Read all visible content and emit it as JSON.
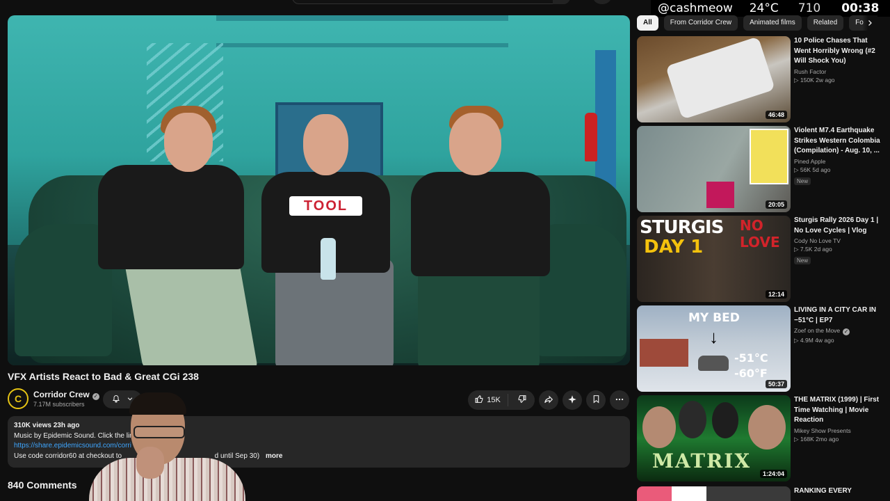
{
  "overlay": {
    "handle": "@cashmeow",
    "temperature": "24°C",
    "count": "710",
    "time": "00:38"
  },
  "video": {
    "title": "VFX Artists React to Bad & Great CGi 238",
    "shirt_text": "TOOL",
    "channel": {
      "name": "Corridor Crew",
      "subscribers": "7.17M subscribers",
      "avatar_letter": "C"
    },
    "actions": {
      "likes": "15K"
    }
  },
  "description": {
    "meta": "310K views  23h ago",
    "line1": "Music by Epidemic Sound. Click the lin",
    "link": "https://share.epidemicsound.com/corri",
    "line3_start": "Use code corridor60 at checkout to",
    "line3_end": "d until Sep 30)",
    "more": "more"
  },
  "comments": {
    "count_label": "840 Comments"
  },
  "chips": [
    "All",
    "From Corridor Crew",
    "Animated films",
    "Related",
    "Fo"
  ],
  "recommendations": [
    {
      "title": "10 Police Chases That Went Horribly Wrong (#2 Will Shock You)",
      "channel": "Rush Factor",
      "stats": "▷ 150K  2w ago",
      "duration": "46:48",
      "badge": ""
    },
    {
      "title": "Violent M7.4 Earthquake Strikes Western Colombia (Compilation) - Aug. 10, ...",
      "channel": "Pined Apple",
      "stats": "▷ 56K  5d ago",
      "duration": "20:05",
      "badge": "New"
    },
    {
      "title": "Sturgis Rally 2026 Day 1 | No Love Cycles | Vlog",
      "channel": "Cody No Love TV",
      "stats": "▷ 7.5K  2d ago",
      "duration": "12:14",
      "badge": "New",
      "thumb_text": {
        "big": "STURGIS",
        "day": "DAY 1",
        "red": "NO LOVE"
      }
    },
    {
      "title": "LIVING IN A CITY CAR IN −51°C | EP7",
      "channel": "Zoef on the Move",
      "stats": "▷ 4.9M  4w ago",
      "duration": "50:37",
      "badge": "",
      "thumb_text": {
        "bed": "MY BED",
        "temp1": "-51°C",
        "temp2": "-60°F"
      }
    },
    {
      "title": "THE MATRIX (1999) | First Time Watching | Movie Reaction",
      "channel": "Mikey Show Presents",
      "stats": "▷ 168K  2mo ago",
      "duration": "1:24:04",
      "badge": "",
      "thumb_text": {
        "matrix": "MATRIX"
      }
    },
    {
      "title": "RANKING EVERY",
      "channel": "",
      "stats": "",
      "duration": "",
      "badge": ""
    }
  ],
  "colors": {
    "background": "#0f0f0f",
    "surface": "#272727",
    "link": "#3ea6ff",
    "channel_avatar_accent": "#e6c414"
  }
}
